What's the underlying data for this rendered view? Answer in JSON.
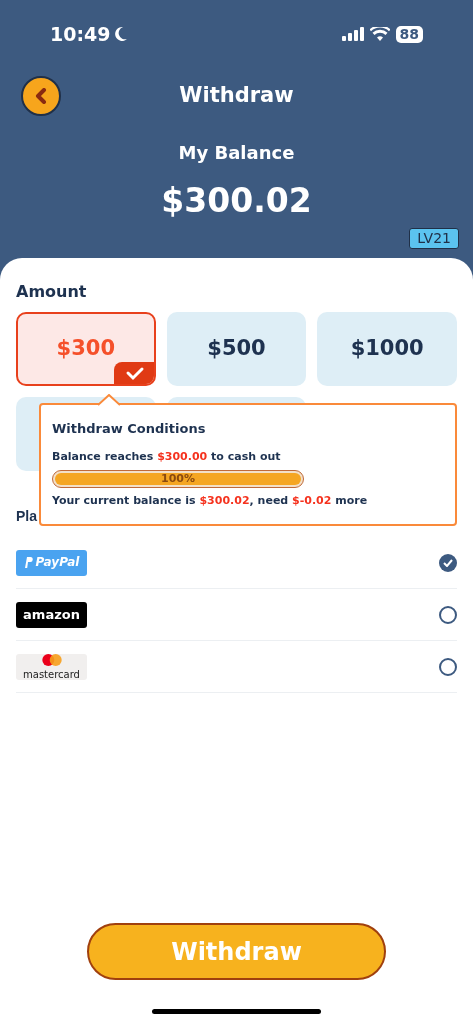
{
  "status_bar": {
    "time": "10:49",
    "battery": "88"
  },
  "header": {
    "title": "Withdraw",
    "balance_label": "My Balance",
    "balance": "$300.02",
    "level_badge": "LV21"
  },
  "amount_section": {
    "title": "Amount"
  },
  "amounts": [
    {
      "label": "$300",
      "selected": true
    },
    {
      "label": "$500",
      "selected": false
    },
    {
      "label": "$1000",
      "selected": false
    }
  ],
  "conditions_popup": {
    "title": "Withdraw Conditions",
    "requirement": "Balance reaches **$300.00** to cash out",
    "progress": {
      "level": 1,
      "label": "100%"
    },
    "status": "Your current balance is **$300.02**, need **$-0.02** more"
  },
  "payment_section": {
    "title": "Pla"
  },
  "payment_methods": [
    {
      "kind": "paypal",
      "label": "PayPal",
      "selected": true
    },
    {
      "kind": "amazon",
      "label": "amazon",
      "selected": false
    },
    {
      "kind": "mastercard",
      "label": "mastercard",
      "selected": false
    }
  ],
  "withdraw_button": {
    "label": "Withdraw"
  }
}
